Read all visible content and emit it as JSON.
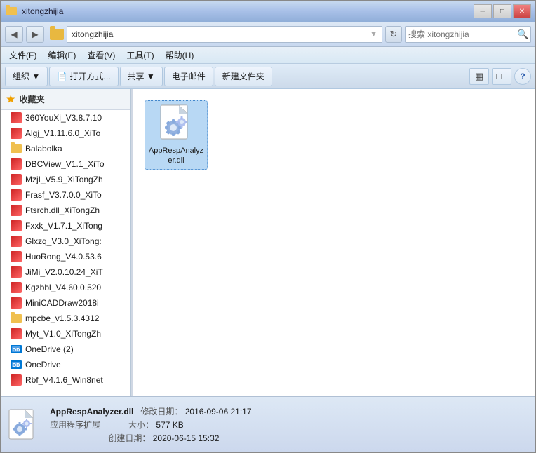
{
  "window": {
    "title": "xitongzhijia",
    "min_label": "─",
    "max_label": "□",
    "close_label": "✕"
  },
  "address_bar": {
    "folder_path": "xitongzhijia",
    "search_placeholder": "搜索 xitongzhijia",
    "refresh_symbol": "↻"
  },
  "menu": {
    "items": [
      {
        "label": "文件(F)"
      },
      {
        "label": "编辑(E)"
      },
      {
        "label": "查看(V)"
      },
      {
        "label": "工具(T)"
      },
      {
        "label": "帮助(H)"
      }
    ]
  },
  "toolbar": {
    "organize_label": "组织 ▼",
    "open_with_label": "📄 打开方式...",
    "share_label": "共享 ▼",
    "email_label": "电子邮件",
    "new_folder_label": "新建文件夹",
    "view_icon": "▦",
    "view_icon2": "□□",
    "help_label": "?"
  },
  "sidebar": {
    "section_label": "收藏夹",
    "items": [
      {
        "label": "360YouXi_V3.8.7.10",
        "type": "app"
      },
      {
        "label": "Algj_V1.11.6.0_XiTo",
        "type": "app"
      },
      {
        "label": "Balabolka",
        "type": "folder"
      },
      {
        "label": "DBCView_V1.1_XiTo",
        "type": "app"
      },
      {
        "label": "MzjI_V5.9_XiTongZh",
        "type": "app"
      },
      {
        "label": "Frasf_V3.7.0.0_XiTo",
        "type": "app"
      },
      {
        "label": "Ftsrch.dll_XiTongZh",
        "type": "app"
      },
      {
        "label": "Fxxk_V1.7.1_XiTong",
        "type": "app"
      },
      {
        "label": "Glxzq_V3.0_XiTong:",
        "type": "app"
      },
      {
        "label": "HuoRong_V4.0.53.6",
        "type": "app"
      },
      {
        "label": "JiMi_V2.0.10.24_XiT",
        "type": "app"
      },
      {
        "label": "Kgzbbl_V4.60.0.520",
        "type": "app"
      },
      {
        "label": "MiniCADDraw2018i",
        "type": "app"
      },
      {
        "label": "mpcbe_v1.5.3.4312",
        "type": "folder"
      },
      {
        "label": "Myt_V1.0_XiTongZh",
        "type": "app"
      },
      {
        "label": "OneDrive (2)",
        "type": "onedrive"
      },
      {
        "label": "OneDrive",
        "type": "onedrive"
      },
      {
        "label": "Rbf_V4.1.6_Win8net",
        "type": "app"
      }
    ]
  },
  "file_pane": {
    "items": [
      {
        "name": "AppRespAnalyzer.dll",
        "type": "dll",
        "selected": true
      }
    ]
  },
  "status_bar": {
    "filename": "AppRespAnalyzer.dll",
    "modify_date_label": "修改日期：",
    "modify_date_value": "2016-09-06 21:17",
    "type_label": "应用程序扩展",
    "size_label": "大小：",
    "size_value": "577 KB",
    "created_label": "创建日期：",
    "created_value": "2020-06-15 15:32"
  },
  "colors": {
    "accent_blue": "#5588cc",
    "folder_yellow": "#e8b840",
    "title_bar_start": "#c8daf0",
    "title_bar_end": "#90aed8",
    "close_btn": "#cc4444"
  }
}
